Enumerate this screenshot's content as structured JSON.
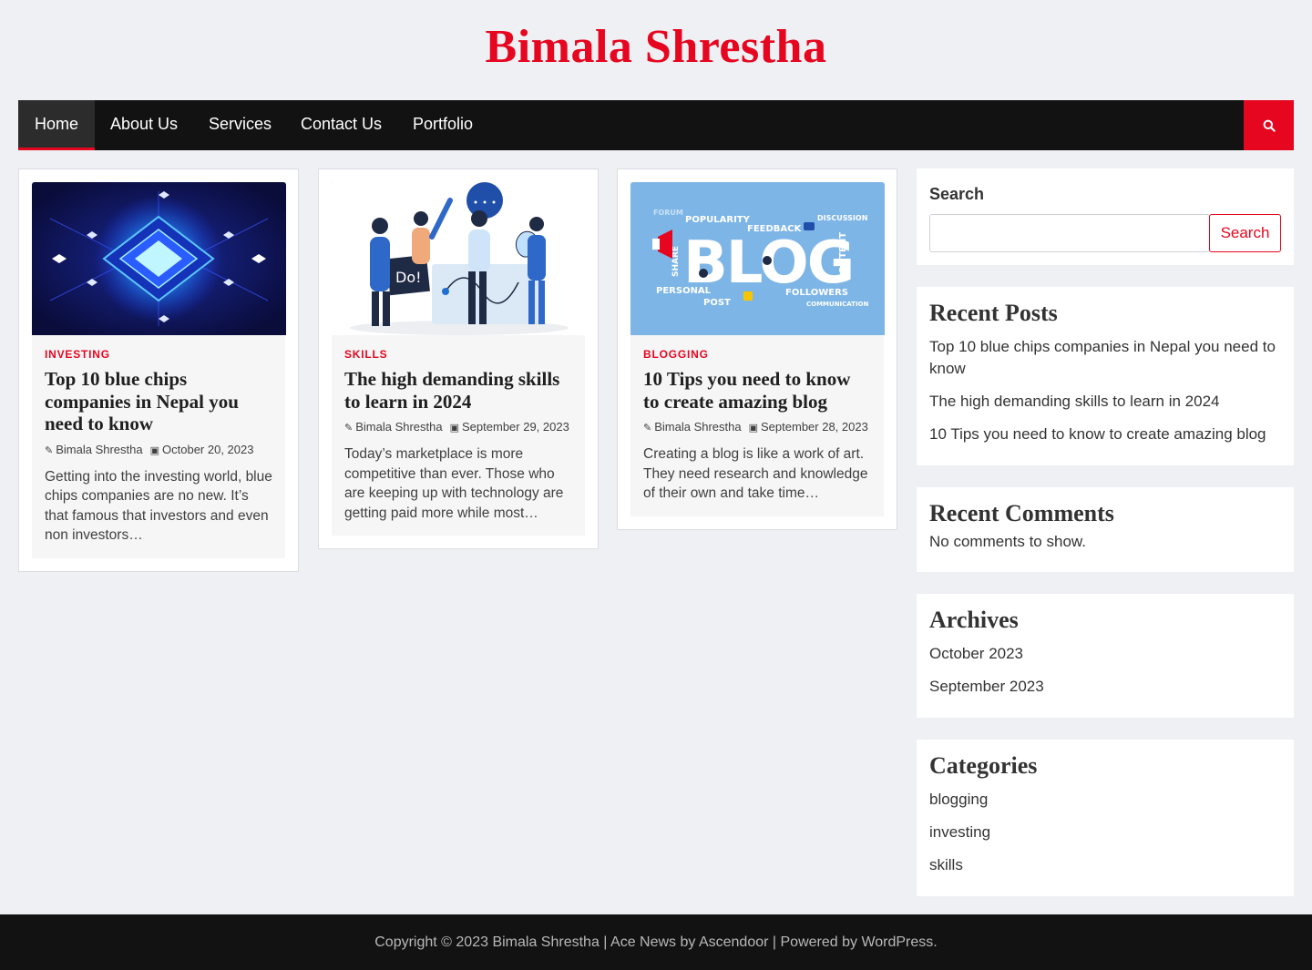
{
  "site": {
    "title": "Bimala Shrestha"
  },
  "nav": {
    "items": [
      "Home",
      "About Us",
      "Services",
      "Contact Us",
      "Portfolio"
    ],
    "active": "Home",
    "search_icon": "search-icon"
  },
  "posts": [
    {
      "category": "INVESTING",
      "title": "Top 10 blue chips companies in Nepal you need to know",
      "author": "Bimala Shrestha",
      "date": "October 20, 2023",
      "excerpt": "Getting into the investing world, blue chips companies are no new. It’s that famous that investors and even non investors…"
    },
    {
      "category": "SKILLS",
      "title": "The high demanding skills to learn in 2024",
      "author": "Bimala Shrestha",
      "date": "September 29, 2023",
      "excerpt": "Today’s marketplace is more competitive than ever. Those who are keeping up with technology are getting paid more while most…"
    },
    {
      "category": "BLOGGING",
      "title": "10 Tips you need to know to create amazing blog",
      "author": "Bimala Shrestha",
      "date": "September 28, 2023",
      "excerpt": "Creating a blog is like a work of art. They need research and knowledge of their own and take time…"
    }
  ],
  "blog_image_words": {
    "big": "BLOG",
    "popularity": "POPULARITY",
    "feedback": "FEEDBACK",
    "discussion": "DISCUSSION",
    "share": "SHARE",
    "content": "CONTENT",
    "personal": "PERSONAL",
    "post": "POST",
    "followers": "FOLLOWERS",
    "communication": "COMMUNICATION",
    "forum": "FORUM"
  },
  "skills_image_words": {
    "sign": "Do!"
  },
  "sidebar": {
    "search": {
      "label": "Search",
      "button": "Search",
      "placeholder": ""
    },
    "recent_posts": {
      "heading": "Recent Posts",
      "items": [
        "Top 10 blue chips companies in Nepal you need to know",
        "The high demanding skills to learn in 2024",
        "10 Tips you need to know to create amazing blog"
      ]
    },
    "recent_comments": {
      "heading": "Recent Comments",
      "empty": "No comments to show."
    },
    "archives": {
      "heading": "Archives",
      "items": [
        "October 2023",
        "September 2023"
      ]
    },
    "categories": {
      "heading": "Categories",
      "items": [
        "blogging",
        "investing",
        "skills"
      ]
    }
  },
  "footer": {
    "copyright": "Copyright © 2023 Bimala Shrestha",
    "sep1": " | ",
    "theme": "Ace News",
    "by": " by ",
    "author": "Ascendoor",
    "sep2": " | ",
    "powered": "Powered by ",
    "platform": "WordPress",
    "end": "."
  },
  "colors": {
    "accent": "#e6061f",
    "nav_bg": "#121212",
    "page_bg": "#eef0f4"
  }
}
